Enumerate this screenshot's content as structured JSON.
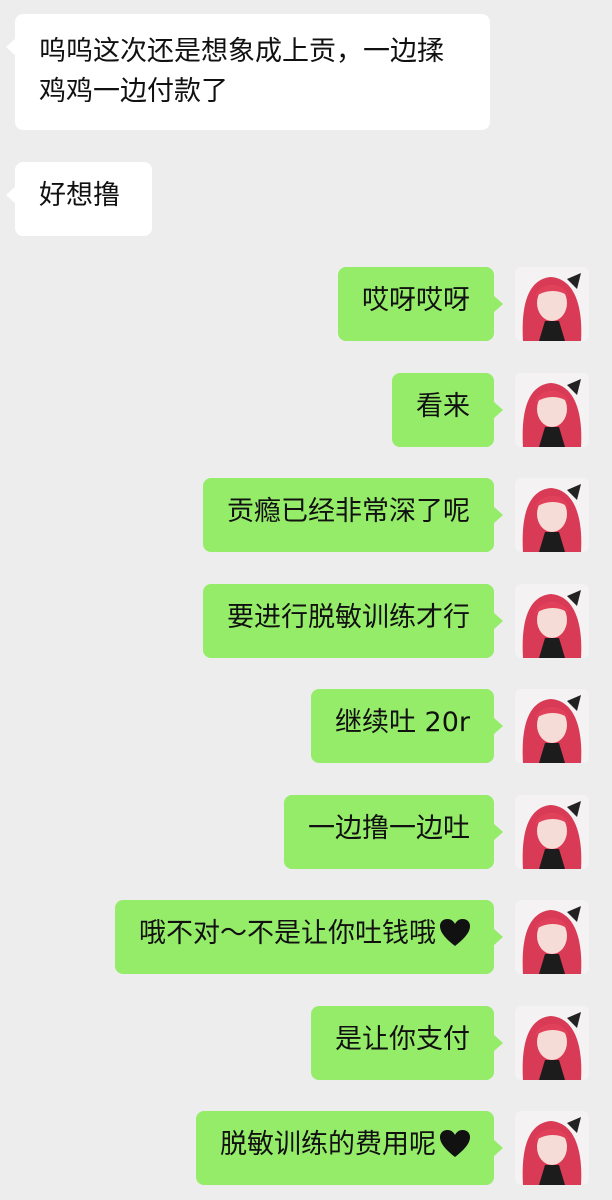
{
  "messages": [
    {
      "side": "in",
      "text": "呜呜这次还是想象成上贡，一边揉鸡鸡一边付款了"
    },
    {
      "side": "in",
      "text": "好想撸"
    },
    {
      "side": "out",
      "text": "哎呀哎呀"
    },
    {
      "side": "out",
      "text": "看来"
    },
    {
      "side": "out",
      "text": "贡瘾已经非常深了呢"
    },
    {
      "side": "out",
      "text": "要进行脱敏训练才行"
    },
    {
      "side": "out",
      "text": "继续吐 20r"
    },
    {
      "side": "out",
      "text": "一边撸一边吐"
    },
    {
      "side": "out",
      "text": "哦不对～不是让你吐钱哦",
      "emoji": "black-heart"
    },
    {
      "side": "out",
      "text": "是让你支付"
    },
    {
      "side": "out",
      "text": "脱敏训练的费用呢",
      "emoji": "black-heart"
    }
  ],
  "colors": {
    "background": "#ededed",
    "incoming_bubble": "#ffffff",
    "outgoing_bubble": "#95ec69",
    "avatar_hair": "#e0405a"
  }
}
